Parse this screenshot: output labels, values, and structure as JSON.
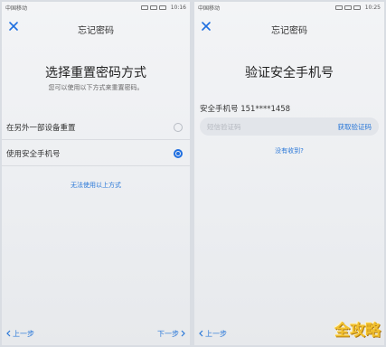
{
  "left": {
    "status": {
      "carrier": "中国移动",
      "time": "10:16"
    },
    "nav": {
      "title": "忘记密码"
    },
    "title": "选择重置密码方式",
    "subtitle": "您可以使用以下方式来重置密码。",
    "options": [
      {
        "label": "在另外一部设备重置",
        "selected": false
      },
      {
        "label": "使用安全手机号",
        "selected": true
      }
    ],
    "alt_link": "无法使用以上方式",
    "bottom": {
      "prev": "上一步",
      "next": "下一步"
    }
  },
  "right": {
    "status": {
      "carrier": "中国移动",
      "time": "10:25"
    },
    "nav": {
      "title": "忘记密码"
    },
    "title": "验证安全手机号",
    "phone_label": "安全手机号",
    "phone_number": "151****1458",
    "code_input": {
      "placeholder": "短信验证码",
      "value": ""
    },
    "get_code": "获取验证码",
    "not_received": "没有收到?",
    "bottom": {
      "prev": "上一步"
    }
  },
  "watermark": "全攻略",
  "colors": {
    "accent": "#1f6fe0",
    "link": "#2a78d8",
    "watermark": "#f2c12e"
  }
}
